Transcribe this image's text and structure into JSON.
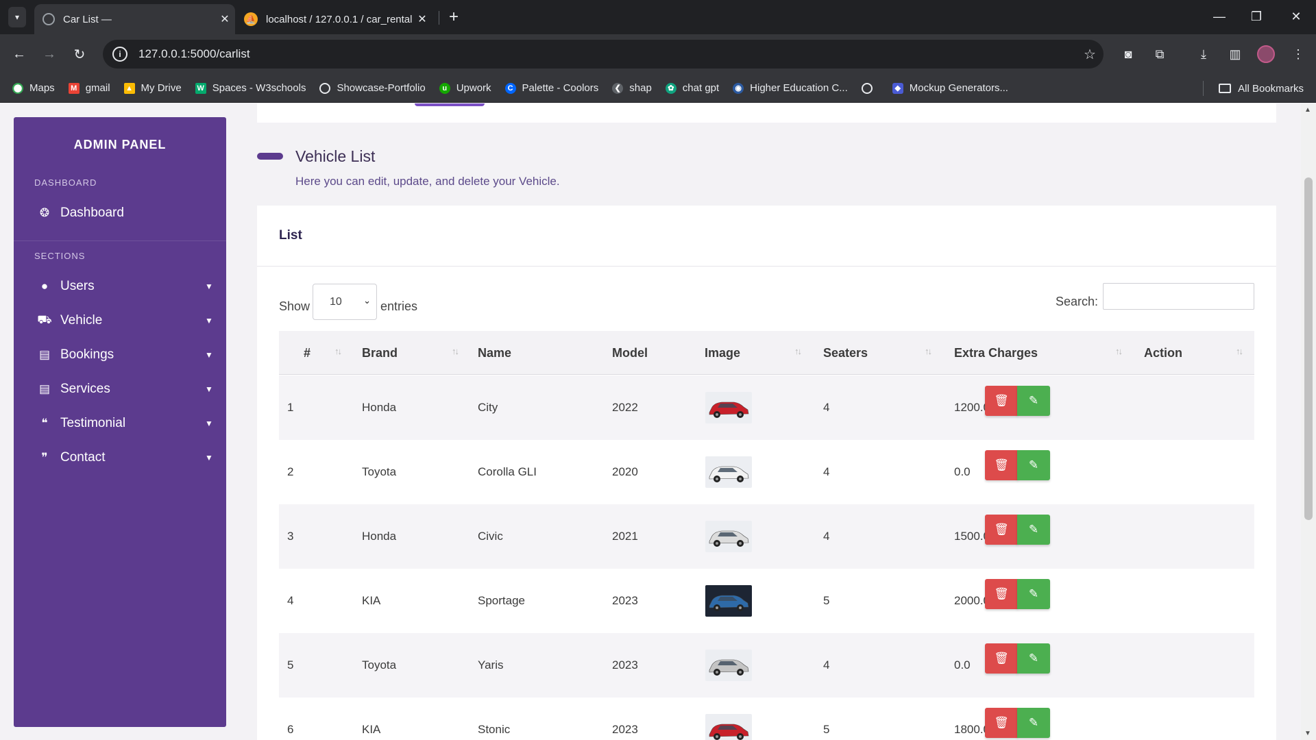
{
  "browser": {
    "tabs": [
      {
        "title": "Car List —",
        "active": true
      },
      {
        "title": "localhost / 127.0.0.1 / car_rental",
        "active": false
      }
    ],
    "url": "127.0.0.1:5000/carlist",
    "bookmarks": [
      "Maps",
      "gmail",
      "My Drive",
      "Spaces - W3schools",
      "Showcase-Portfolio",
      "Upwork",
      "Palette - Coolors",
      "shap",
      "chat gpt",
      "Higher Education C...",
      "",
      "Mockup Generators..."
    ],
    "all_bookmarks": "All Bookmarks"
  },
  "sidebar": {
    "title": "ADMIN PANEL",
    "dashboard_heading": "DASHBOARD",
    "dashboard_item": "Dashboard",
    "sections_heading": "SECTIONS",
    "items": [
      {
        "label": "Users",
        "icon": "user-icon"
      },
      {
        "label": "Vehicle",
        "icon": "car-icon"
      },
      {
        "label": "Bookings",
        "icon": "id-card-icon"
      },
      {
        "label": "Services",
        "icon": "id-card-icon"
      },
      {
        "label": "Testimonial",
        "icon": "comments-icon"
      },
      {
        "label": "Contact",
        "icon": "comment-icon"
      }
    ]
  },
  "page": {
    "title": "Vehicle List",
    "subtitle": "Here you can edit, update, and delete your Vehicle."
  },
  "card": {
    "title": "List",
    "show_label": "Show",
    "entries_value": "10",
    "entries_label": "entries",
    "search_label": "Search:",
    "search_value": ""
  },
  "table": {
    "headers": [
      "#",
      "Brand",
      "Name",
      "Model",
      "Image",
      "Seaters",
      "Extra Charges",
      "Action"
    ],
    "rows": [
      {
        "id": "1",
        "brand": "Honda",
        "name": "City",
        "model": "2022",
        "seaters": "4",
        "extra": "1200.0",
        "car_color": "#c8202a"
      },
      {
        "id": "2",
        "brand": "Toyota",
        "name": "Corolla GLI",
        "model": "2020",
        "seaters": "4",
        "extra": "0.0",
        "car_color": "#f2f2f2"
      },
      {
        "id": "3",
        "brand": "Honda",
        "name": "Civic",
        "model": "2021",
        "seaters": "4",
        "extra": "1500.0",
        "car_color": "#dcdcdc"
      },
      {
        "id": "4",
        "brand": "KIA",
        "name": "Sportage",
        "model": "2023",
        "seaters": "5",
        "extra": "2000.0",
        "car_color": "#2e6aa8"
      },
      {
        "id": "5",
        "brand": "Toyota",
        "name": "Yaris",
        "model": "2023",
        "seaters": "4",
        "extra": "0.0",
        "car_color": "#c4c4c4"
      },
      {
        "id": "6",
        "brand": "KIA",
        "name": "Stonic",
        "model": "2023",
        "seaters": "5",
        "extra": "1800.0",
        "car_color": "#c8202a"
      }
    ]
  },
  "colors": {
    "sidebar": "#5c3b8e",
    "delete": "#dd4b4b",
    "edit": "#4caf50"
  }
}
